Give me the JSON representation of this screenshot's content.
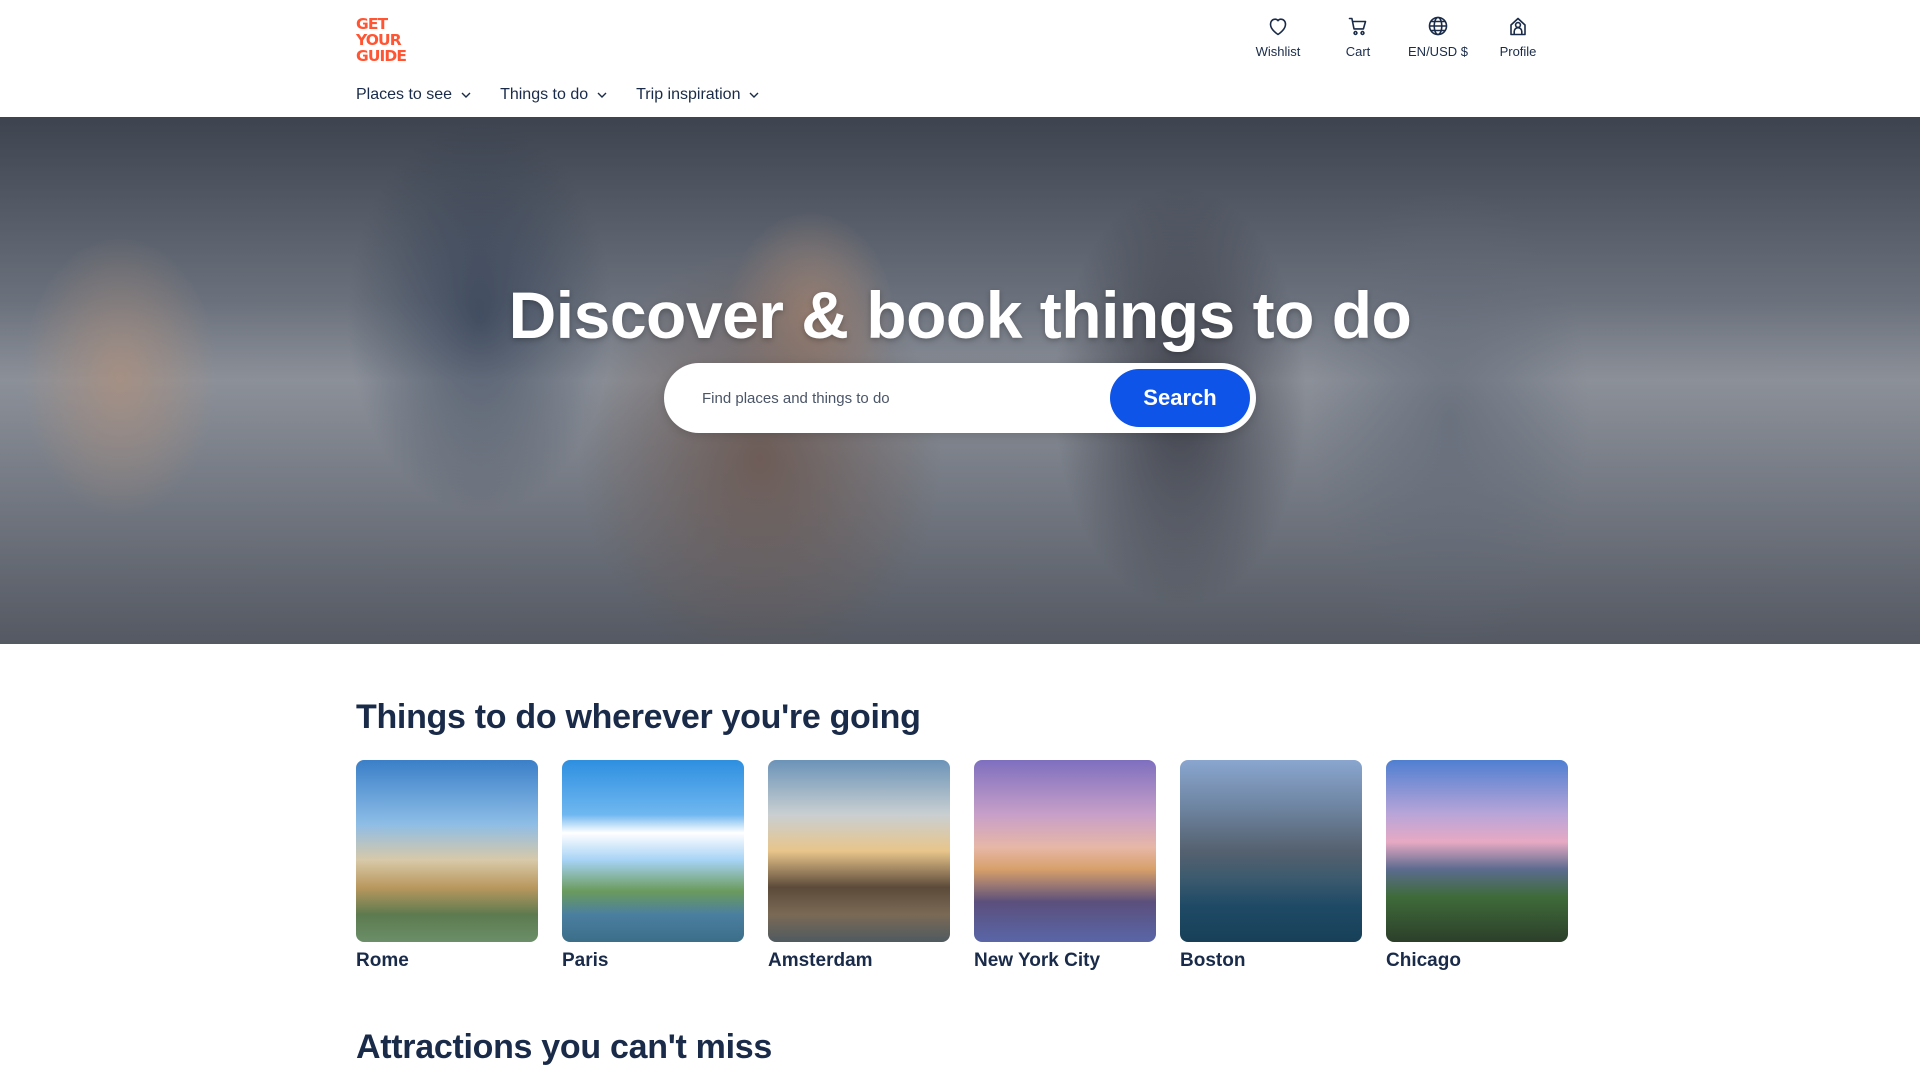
{
  "header": {
    "logo": {
      "line1": "GET",
      "line2": "YOUR",
      "line3": "GUIDE"
    },
    "utility_nav": [
      {
        "label": "Wishlist",
        "icon": "heart-icon"
      },
      {
        "label": "Cart",
        "icon": "cart-icon"
      },
      {
        "label": "EN/USD $",
        "icon": "globe-icon"
      },
      {
        "label": "Profile",
        "icon": "profile-icon"
      }
    ],
    "main_nav": [
      {
        "label": "Places to see",
        "icon": "chevron-down-icon"
      },
      {
        "label": "Things to do",
        "icon": "chevron-down-icon"
      },
      {
        "label": "Trip inspiration",
        "icon": "chevron-down-icon"
      }
    ]
  },
  "hero": {
    "title": "Discover & book things to do",
    "search": {
      "placeholder": "Find places and things to do",
      "value": "",
      "button_label": "Search"
    }
  },
  "destinations": {
    "title": "Things to do wherever you're going",
    "items": [
      {
        "name": "Rome"
      },
      {
        "name": "Paris"
      },
      {
        "name": "Amsterdam"
      },
      {
        "name": "New York City"
      },
      {
        "name": "Boston"
      },
      {
        "name": "Chicago"
      }
    ]
  },
  "attractions": {
    "title": "Attractions you can't miss"
  },
  "colors": {
    "brand": "#ff5533",
    "primary_button": "#0f54e8",
    "text": "#1a2b49",
    "background": "#ffffff"
  }
}
